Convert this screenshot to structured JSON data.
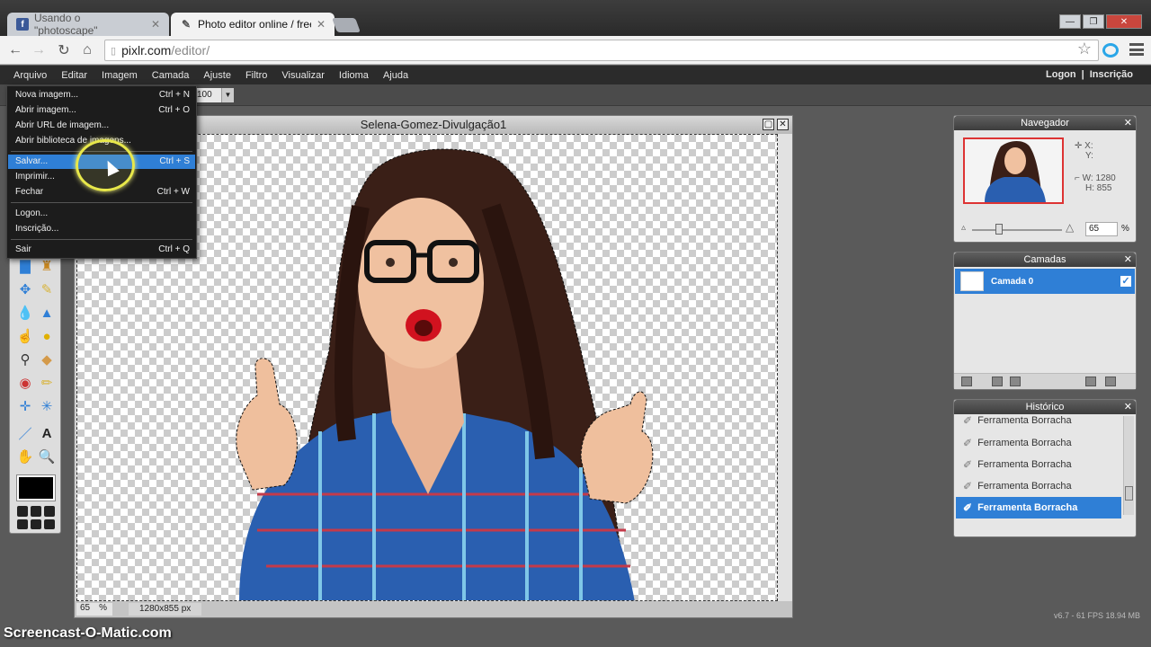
{
  "browser": {
    "tabs": [
      {
        "label": "Usando o \"photoscape\"",
        "favicon": "facebook-icon"
      },
      {
        "label": "Photo editor online / free",
        "favicon": "pencil-icon"
      }
    ],
    "url_host": "pixlr.com",
    "url_path": "/editor/"
  },
  "menubar": {
    "items": [
      "Arquivo",
      "Editar",
      "Imagem",
      "Camada",
      "Ajuste",
      "Filtro",
      "Visualizar",
      "Idioma",
      "Ajuda"
    ],
    "logon": "Logon",
    "separator": "|",
    "signup": "Inscrição"
  },
  "options": {
    "zoom_value": "100"
  },
  "file_menu": {
    "items": [
      {
        "label": "Nova imagem...",
        "shortcut": "Ctrl + N"
      },
      {
        "label": "Abrir imagem...",
        "shortcut": "Ctrl + O"
      },
      {
        "label": "Abrir URL de imagem...",
        "shortcut": ""
      },
      {
        "label": "Abrir biblioteca de imagens...",
        "shortcut": ""
      },
      {
        "label": "Salvar...",
        "shortcut": "Ctrl + S",
        "selected": true
      },
      {
        "label": "Imprimir...",
        "shortcut": ""
      },
      {
        "label": "Fechar",
        "shortcut": "Ctrl + W"
      },
      {
        "label": "Logon...",
        "shortcut": ""
      },
      {
        "label": "Inscrição...",
        "shortcut": ""
      },
      {
        "label": "Sair",
        "shortcut": "Ctrl + Q"
      }
    ]
  },
  "document": {
    "title": "Selena-Gomez-Divulgação1",
    "zoom": "65",
    "zoom_unit": "%",
    "dimensions": "1280x855 px"
  },
  "navigator": {
    "title": "Navegador",
    "x_label": "X:",
    "y_label": "Y:",
    "w_label": "W: 1280",
    "h_label": "H:  855",
    "zoom": "65",
    "zoom_unit": "%"
  },
  "layers": {
    "title": "Camadas",
    "items": [
      {
        "name": "Camada 0",
        "visible": true
      }
    ]
  },
  "history": {
    "title": "Histórico",
    "items": [
      {
        "label": "Ferramenta Borracha"
      },
      {
        "label": "Ferramenta Borracha"
      },
      {
        "label": "Ferramenta Borracha"
      },
      {
        "label": "Ferramenta Borracha"
      },
      {
        "label": "Ferramenta Borracha",
        "selected": true
      }
    ]
  },
  "footer": {
    "version": "v6.7 - 61 FPS 18.94 MB",
    "watermark": "Screencast-O-Matic.com"
  },
  "colors": {
    "selection_blue": "#2f7fd6",
    "app_dark": "#2b2b2b",
    "highlight_yellow": "#e8e84a"
  }
}
